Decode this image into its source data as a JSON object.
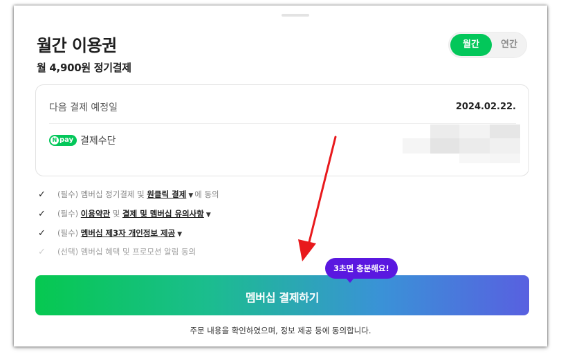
{
  "plan": {
    "title": "월간 이용권",
    "price": "월 4,900원 정기결제"
  },
  "period_toggle": {
    "options": [
      "월간",
      "연간"
    ],
    "selected": "월간"
  },
  "payment_info": {
    "next_date_label": "다음 결제 예정일",
    "next_date_value": "2024.02.22.",
    "method_label": "결제수단",
    "method_logo": {
      "n": "N",
      "text": "pay"
    }
  },
  "agreements": [
    {
      "prefix": "(필수) 멤버십 정기결제 및 ",
      "link": "원클릭 결제",
      "suffix": "에 동의",
      "checked": true
    },
    {
      "prefix": "(필수) ",
      "link": "이용약관",
      "mid": " 및 ",
      "link2": "결제 및 멤버십 유의사항",
      "checked": true
    },
    {
      "prefix": "(필수) ",
      "link": "멤버십 제3자 개인정보 제공",
      "checked": true
    },
    {
      "prefix": "(선택) 멤버십 혜택 및 프로모션 알림 동의",
      "checked": false
    }
  ],
  "cta": {
    "label": "멤버십 결제하기",
    "bubble": "3초면 충분해요!"
  },
  "footer": "주문 내용을 확인하였으며, 정보 제공 등에 동의합니다.",
  "colors": {
    "brand_green": "#03c75a",
    "bubble_purple": "#5a18e0",
    "annotation_red": "#e8191c"
  },
  "icons": [
    "check-icon",
    "chevron-down-icon",
    "npay-logo-icon",
    "red-arrow-annotation"
  ]
}
